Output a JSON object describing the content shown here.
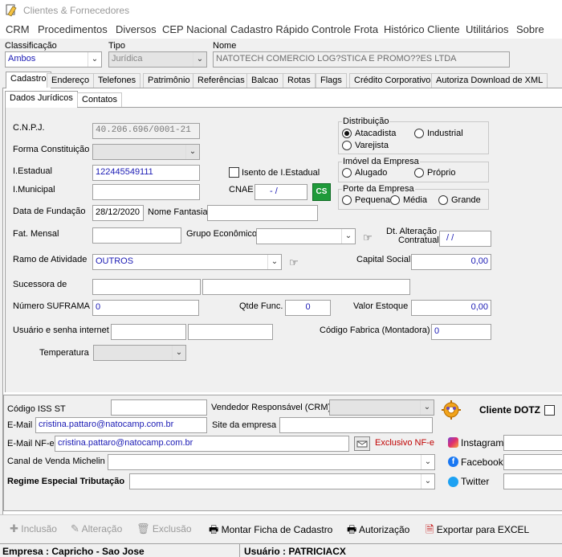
{
  "window": {
    "title": "Clientes & Fornecedores"
  },
  "menu": [
    "CRM",
    "Procedimentos",
    "Diversos",
    "CEP Nacional",
    "Cadastro Rápido",
    "Controle Frota",
    "Histórico Cliente",
    "Utilitários",
    "Sobre"
  ],
  "header": {
    "classificacao_label": "Classificação",
    "classificacao_value": "Ambos",
    "tipo_label": "Tipo",
    "tipo_value": "Jurídica",
    "nome_label": "Nome",
    "nome_value": "NATOTECH COMERCIO LOG?STICA E PROMO??ES LTDA"
  },
  "tabs": [
    "Cadastro",
    "Endereço",
    "Telefones",
    "Patrimônio",
    "Referências",
    "Balcao",
    "Rotas",
    "Flags",
    "Crédito Corporativo",
    "Autoriza Download de XML"
  ],
  "subtabs": [
    "Dados Jurídicos",
    "Contatos"
  ],
  "form": {
    "cnpj_label": "C.N.P.J.",
    "cnpj_value": "40.206.696/0001-21",
    "forma_label": "Forma Constituição",
    "ie_label": "I.Estadual",
    "ie_value": "122445549111",
    "isento_label": "Isento de I.Estadual",
    "im_label": "I.Municipal",
    "cnae_label": "CNAE",
    "cnae_value": "- /",
    "cnae_button": "CS",
    "fundacao_label": "Data de Fundação",
    "fundacao_value": "28/12/2020",
    "fantasia_label": "Nome Fantasia",
    "fat_label": "Fat. Mensal",
    "grupo_label": "Grupo Econômico",
    "alteracao_label1": "Dt. Alteração",
    "alteracao_label2": "Contratual",
    "alteracao_value": "/  /",
    "ramo_label": "Ramo de Atividade",
    "ramo_value": "OUTROS",
    "capital_label": "Capital Social",
    "capital_value": "0,00",
    "sucessora_label": "Sucessora de",
    "suframa_label": "Número SUFRAMA",
    "suframa_value": "0",
    "qtde_label": "Qtde Func.",
    "qtde_value": "0",
    "estoque_label": "Valor Estoque",
    "estoque_value": "0,00",
    "usuario_label": "Usuário e senha internet",
    "codigo_fabrica_label": "Código Fabrica (Montadora)",
    "codigo_fabrica_value": "0",
    "temperatura_label": "Temperatura"
  },
  "groups": {
    "distribuicao": {
      "title": "Distribuição",
      "options": [
        "Atacadista",
        "Industrial",
        "Varejista"
      ],
      "selected": "Atacadista"
    },
    "imovel": {
      "title": "Imóvel da Empresa",
      "options": [
        "Alugado",
        "Próprio"
      ],
      "selected": ""
    },
    "porte": {
      "title": "Porte da Empresa",
      "options": [
        "Pequena",
        "Média",
        "Grande"
      ],
      "selected": ""
    }
  },
  "lower": {
    "iss_label": "Código ISS ST",
    "vendedor_label": "Vendedor Responsável (CRM)",
    "dotz_label": "Cliente DOTZ",
    "email_label": "E-Mail",
    "email_value": "cristina.pattaro@natocamp.com.br",
    "site_label": "Site da empresa",
    "email_nfe_label": "E-Mail NF-e",
    "email_nfe_value": "cristina.pattaro@natocamp.com.br",
    "exclusivo_label": "Exclusivo NF-e",
    "canal_label": "Canal de Venda Michelin",
    "regime_label": "Regime Especial Tributação",
    "instagram_label": "Instagram",
    "facebook_label": "Facebook",
    "twitter_label": "Twitter"
  },
  "toolbar": [
    "Inclusão",
    "Alteração",
    "Exclusão",
    "Montar Ficha de Cadastro",
    "Autorização",
    "Exportar para EXCEL"
  ],
  "status": {
    "empresa": "Empresa : Capricho - Sao Jose",
    "usuario": "Usuário : PATRICIACX"
  },
  "colors": {
    "value_blue": "#1a1ab4",
    "exclusivo_red": "#c00000",
    "cs_green": "#1f9a3a"
  }
}
